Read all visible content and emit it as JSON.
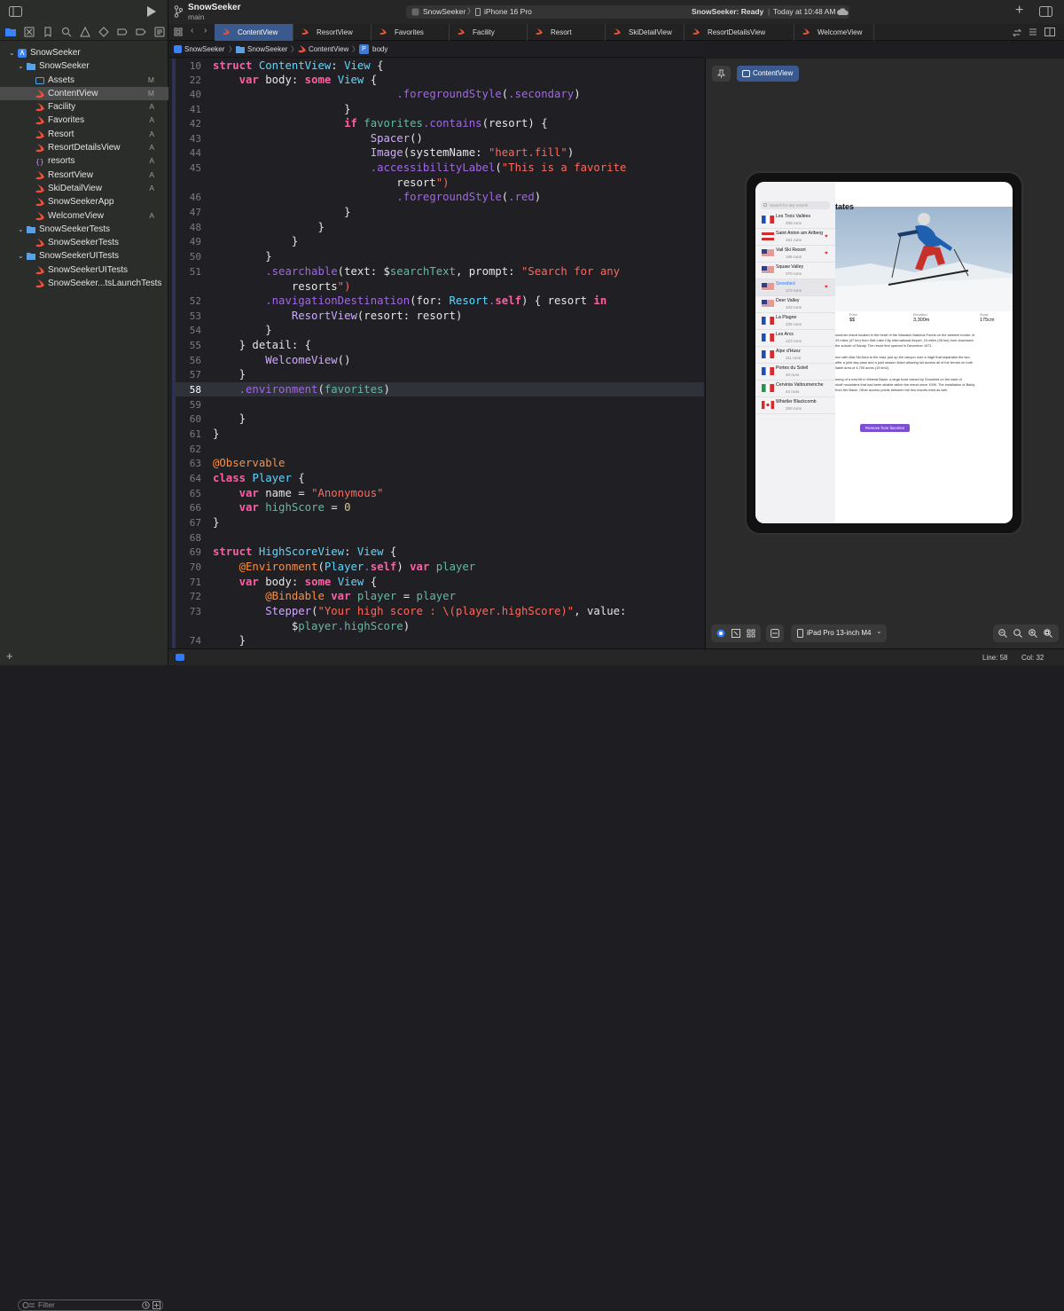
{
  "project": {
    "name": "SnowSeeker",
    "branch": "main"
  },
  "scheme": {
    "name": "SnowSeeker",
    "device": "iPhone 16 Pro",
    "status_bold": "SnowSeeker: Ready",
    "status_time": "Today at 10:48 AM"
  },
  "tabs": [
    "ContentView",
    "ResortView",
    "Favorites",
    "Facility",
    "Resort",
    "SkiDetailView",
    "ResortDetailsView",
    "WelcomeView"
  ],
  "breadcrumb": [
    "SnowSeeker",
    "SnowSeeker",
    "ContentView",
    "body"
  ],
  "navigator": [
    {
      "label": "SnowSeeker",
      "status": "",
      "icon": "app"
    },
    {
      "label": "SnowSeeker",
      "status": "",
      "icon": "folder"
    },
    {
      "label": "Assets",
      "status": "M",
      "icon": "assets"
    },
    {
      "label": "ContentView",
      "status": "M",
      "icon": "swift"
    },
    {
      "label": "Facility",
      "status": "A",
      "icon": "swift"
    },
    {
      "label": "Favorites",
      "status": "A",
      "icon": "swift"
    },
    {
      "label": "Resort",
      "status": "A",
      "icon": "swift"
    },
    {
      "label": "ResortDetailsView",
      "status": "A",
      "icon": "swift"
    },
    {
      "label": "resorts",
      "status": "A",
      "icon": "json"
    },
    {
      "label": "ResortView",
      "status": "A",
      "icon": "swift"
    },
    {
      "label": "SkiDetailView",
      "status": "A",
      "icon": "swift"
    },
    {
      "label": "SnowSeekerApp",
      "status": "",
      "icon": "swift"
    },
    {
      "label": "WelcomeView",
      "status": "A",
      "icon": "swift"
    },
    {
      "label": "SnowSeekerTests",
      "status": "",
      "icon": "folder"
    },
    {
      "label": "SnowSeekerTests",
      "status": "",
      "icon": "swift"
    },
    {
      "label": "SnowSeekerUITests",
      "status": "",
      "icon": "folder"
    },
    {
      "label": "SnowSeekerUITests",
      "status": "",
      "icon": "swift"
    },
    {
      "label": "SnowSeeker...tsLaunchTests",
      "status": "",
      "icon": "swift"
    }
  ],
  "filter_placeholder": "Filter",
  "code_lines": [
    {
      "n": "10",
      "t": "struct ContentView: View {"
    },
    {
      "n": "22",
      "t": "    var body: some View {"
    },
    {
      "n": "40",
      "t": "                            .foregroundStyle(.secondary)"
    },
    {
      "n": "41",
      "t": "                    }"
    },
    {
      "n": "42",
      "t": "                    if favorites.contains(resort) {"
    },
    {
      "n": "43",
      "t": "                        Spacer()"
    },
    {
      "n": "44",
      "t": "                        Image(systemName: \"heart.fill\")"
    },
    {
      "n": "45",
      "t": "                        .accessibilityLabel(\"This is a favorite"
    },
    {
      "n": "",
      "t": "                            resort\")"
    },
    {
      "n": "46",
      "t": "                            .foregroundStyle(.red)"
    },
    {
      "n": "47",
      "t": "                    }"
    },
    {
      "n": "48",
      "t": "                }"
    },
    {
      "n": "49",
      "t": "            }"
    },
    {
      "n": "50",
      "t": "        }"
    },
    {
      "n": "51",
      "t": "        .searchable(text: $searchText, prompt: \"Search for any"
    },
    {
      "n": "",
      "t": "            resorts\")"
    },
    {
      "n": "52",
      "t": "        .navigationDestination(for: Resort.self) { resort in"
    },
    {
      "n": "53",
      "t": "            ResortView(resort: resort)"
    },
    {
      "n": "54",
      "t": "        }"
    },
    {
      "n": "55",
      "t": "    } detail: {"
    },
    {
      "n": "56",
      "t": "        WelcomeView()"
    },
    {
      "n": "57",
      "t": "    }"
    },
    {
      "n": "58",
      "t": "    .environment(favorites)"
    },
    {
      "n": "59",
      "t": ""
    },
    {
      "n": "60",
      "t": "    }"
    },
    {
      "n": "61",
      "t": "}"
    },
    {
      "n": "62",
      "t": ""
    },
    {
      "n": "63",
      "t": "@Observable"
    },
    {
      "n": "64",
      "t": "class Player {"
    },
    {
      "n": "65",
      "t": "    var name = \"Anonymous\""
    },
    {
      "n": "66",
      "t": "    var highScore = 0"
    },
    {
      "n": "67",
      "t": "}"
    },
    {
      "n": "68",
      "t": ""
    },
    {
      "n": "69",
      "t": "struct HighScoreView: View {"
    },
    {
      "n": "70",
      "t": "    @Environment(Player.self) var player"
    },
    {
      "n": "71",
      "t": "    var body: some View {"
    },
    {
      "n": "72",
      "t": "        @Bindable var player = player"
    },
    {
      "n": "73",
      "t": "        Stepper(\"Your high score : \\(player.highScore)\", value:"
    },
    {
      "n": "",
      "t": "            $player.highScore)"
    },
    {
      "n": "74",
      "t": "    }"
    }
  ],
  "preview": {
    "chip": "ContentView",
    "device": "iPad Pro 13-inch M4",
    "app": {
      "search_placeholder": "Search for any resorts",
      "detail_title_fragment": "tates",
      "resorts": [
        {
          "name": "Les Trois Vallées",
          "runs": "335 runs",
          "fav": false,
          "flag": "fr"
        },
        {
          "name": "Saint Anton am Arlberg",
          "runs": "161 runs",
          "fav": true,
          "flag": "at"
        },
        {
          "name": "Vail Ski Resort",
          "runs": "195 runs",
          "fav": true,
          "flag": "us"
        },
        {
          "name": "Squaw Valley",
          "runs": "270 runs",
          "fav": false,
          "flag": "us"
        },
        {
          "name": "Snowbird",
          "runs": "170 runs",
          "fav": true,
          "flag": "us"
        },
        {
          "name": "Deer Valley",
          "runs": "103 runs",
          "fav": false,
          "flag": "us"
        },
        {
          "name": "La Plagne",
          "runs": "225 runs",
          "fav": false,
          "flag": "fr"
        },
        {
          "name": "Les Arcs",
          "runs": "123 runs",
          "fav": false,
          "flag": "fr"
        },
        {
          "name": "Alpe d'Huez",
          "runs": "111 runs",
          "fav": false,
          "flag": "fr"
        },
        {
          "name": "Portes du Soleil",
          "runs": "34 runs",
          "fav": false,
          "flag": "fr"
        },
        {
          "name": "Cervinia Valtournenche",
          "runs": "44 runs",
          "fav": false,
          "flag": "it"
        },
        {
          "name": "Whistler Blackcomb",
          "runs": "200 runs",
          "fav": false,
          "flag": "ca"
        }
      ],
      "stats": [
        {
          "label": "Price",
          "value": "$$"
        },
        {
          "label": "Elevation",
          "value": "3,300m"
        },
        {
          "label": "Snow",
          "value": "175cm"
        }
      ],
      "description": [
        "summer resort located in the heart of the Wasatch National Forest on the western border of",
        "29 miles (47 km) from Salt Lake City International Airport, 24 miles (38 km) from downtown",
        "the suburb of Sandy. The resort first opened in December 1971.",
        "",
        "rion with Alta Ski Area to the east, just up the canyon over a ridge that separates the two.",
        "offer a joint day pass and a joint season ticket allowing full access all of the terrain on both",
        "ilable area of 4,700 acres (19 km2).",
        "",
        "ening of a new lift in Mineral Basin, a large bowl owned by Snowbird on the back of",
        "nkoff mountains that had been skiable within the resort since 1999. The installation of Baldy",
        "from the Basin. Other access points between the two resorts exist as well."
      ],
      "button": "Remove from favorites"
    }
  },
  "cursor": {
    "line": "Line: 58",
    "col": "Col: 32"
  }
}
